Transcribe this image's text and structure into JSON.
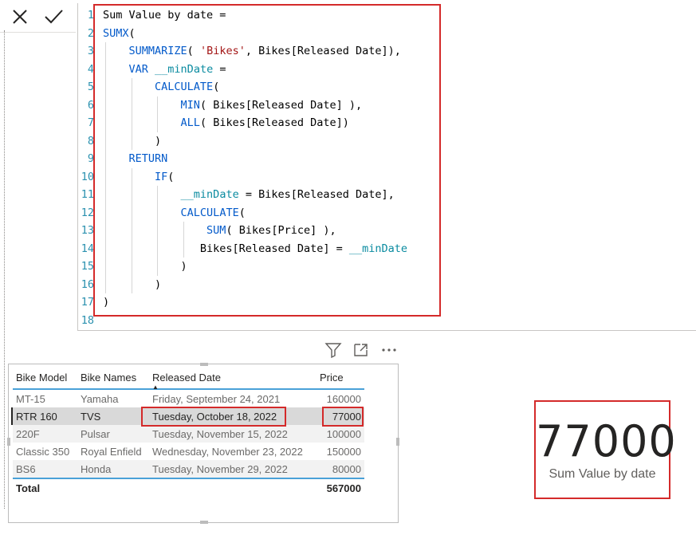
{
  "formula_bar": {
    "cancel_icon": "close-x-icon",
    "commit_icon": "checkmark-icon"
  },
  "editor": {
    "line_numbers": [
      "1",
      "2",
      "3",
      "4",
      "5",
      "6",
      "7",
      "8",
      "9",
      "10",
      "11",
      "12",
      "13",
      "14",
      "15",
      "16",
      "17",
      "18"
    ],
    "highlight_color": "#d42a2a"
  },
  "visual_header": {
    "icons": [
      "filter-icon",
      "focus-mode-icon",
      "more-options-icon"
    ]
  },
  "table": {
    "columns": [
      "Bike Model",
      "Bike Names",
      "Released Date",
      "Price"
    ],
    "sorted_column": "Released Date",
    "rows": [
      {
        "model": "MT-15",
        "name": "Yamaha",
        "date": "Friday, September 24, 2021",
        "price": "160000"
      },
      {
        "model": "RTR 160",
        "name": "TVS",
        "date": "Tuesday, October 18, 2022",
        "price": "77000"
      },
      {
        "model": "220F",
        "name": "Pulsar",
        "date": "Tuesday, November 15, 2022",
        "price": "100000"
      },
      {
        "model": "Classic 350",
        "name": "Royal Enfield",
        "date": "Wednesday, November 23, 2022",
        "price": "150000"
      },
      {
        "model": "BS6",
        "name": "Honda",
        "date": "Tuesday, November 29, 2022",
        "price": "80000"
      }
    ],
    "total_label": "Total",
    "total_value": "567000",
    "header_line_color": "#4aa1d8"
  },
  "card": {
    "value": "77000",
    "label": "Sum Value by date"
  }
}
